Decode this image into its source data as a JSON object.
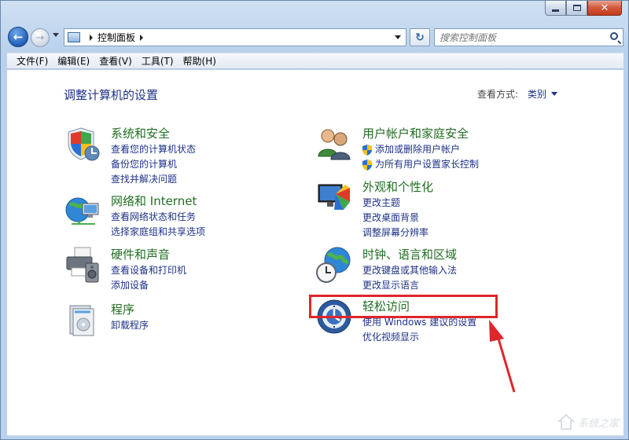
{
  "window": {
    "close_glyph": "✕"
  },
  "nav": {
    "address_text": "控制面板",
    "search_placeholder": "搜索控制面板"
  },
  "menu": [
    "文件(F)",
    "编辑(E)",
    "查看(V)",
    "工具(T)",
    "帮助(H)"
  ],
  "page": {
    "title": "调整计算机的设置",
    "view_by_label": "查看方式:",
    "view_by_value": "类别"
  },
  "categories": [
    {
      "title": "系统和安全",
      "icon": "shield-icon",
      "links": [
        "查看您的计算机状态",
        "备份您的计算机",
        "查找并解决问题"
      ]
    },
    {
      "title": "网络和 Internet",
      "icon": "network-globe-icon",
      "links": [
        "查看网络状态和任务",
        "选择家庭组和共享选项"
      ]
    },
    {
      "title": "硬件和声音",
      "icon": "printer-speaker-icon",
      "links": [
        "查看设备和打印机",
        "添加设备"
      ]
    },
    {
      "title": "程序",
      "icon": "programs-icon",
      "links": [
        "卸载程序"
      ]
    },
    {
      "title": "用户帐户和家庭安全",
      "icon": "users-icon",
      "links": [
        "添加或删除用户帐户",
        "为所有用户设置家长控制"
      ]
    },
    {
      "title": "外观和个性化",
      "icon": "monitor-palette-icon",
      "links": [
        "更改主题",
        "更改桌面背景",
        "调整屏幕分辨率"
      ]
    },
    {
      "title": "时钟、语言和区域",
      "icon": "clock-globe-icon",
      "links": [
        "更改键盘或其他输入法",
        "更改显示语言"
      ]
    },
    {
      "title": "轻松访问",
      "icon": "ease-of-access-icon",
      "links": [
        "使用 Windows 建议的设置",
        "优化视频显示"
      ]
    }
  ],
  "annotation": {
    "highlight_color": "#e0262b"
  },
  "colors": {
    "category_title": "#216e22",
    "link": "#1e3287"
  },
  "watermark": {
    "text": "系统之家"
  }
}
